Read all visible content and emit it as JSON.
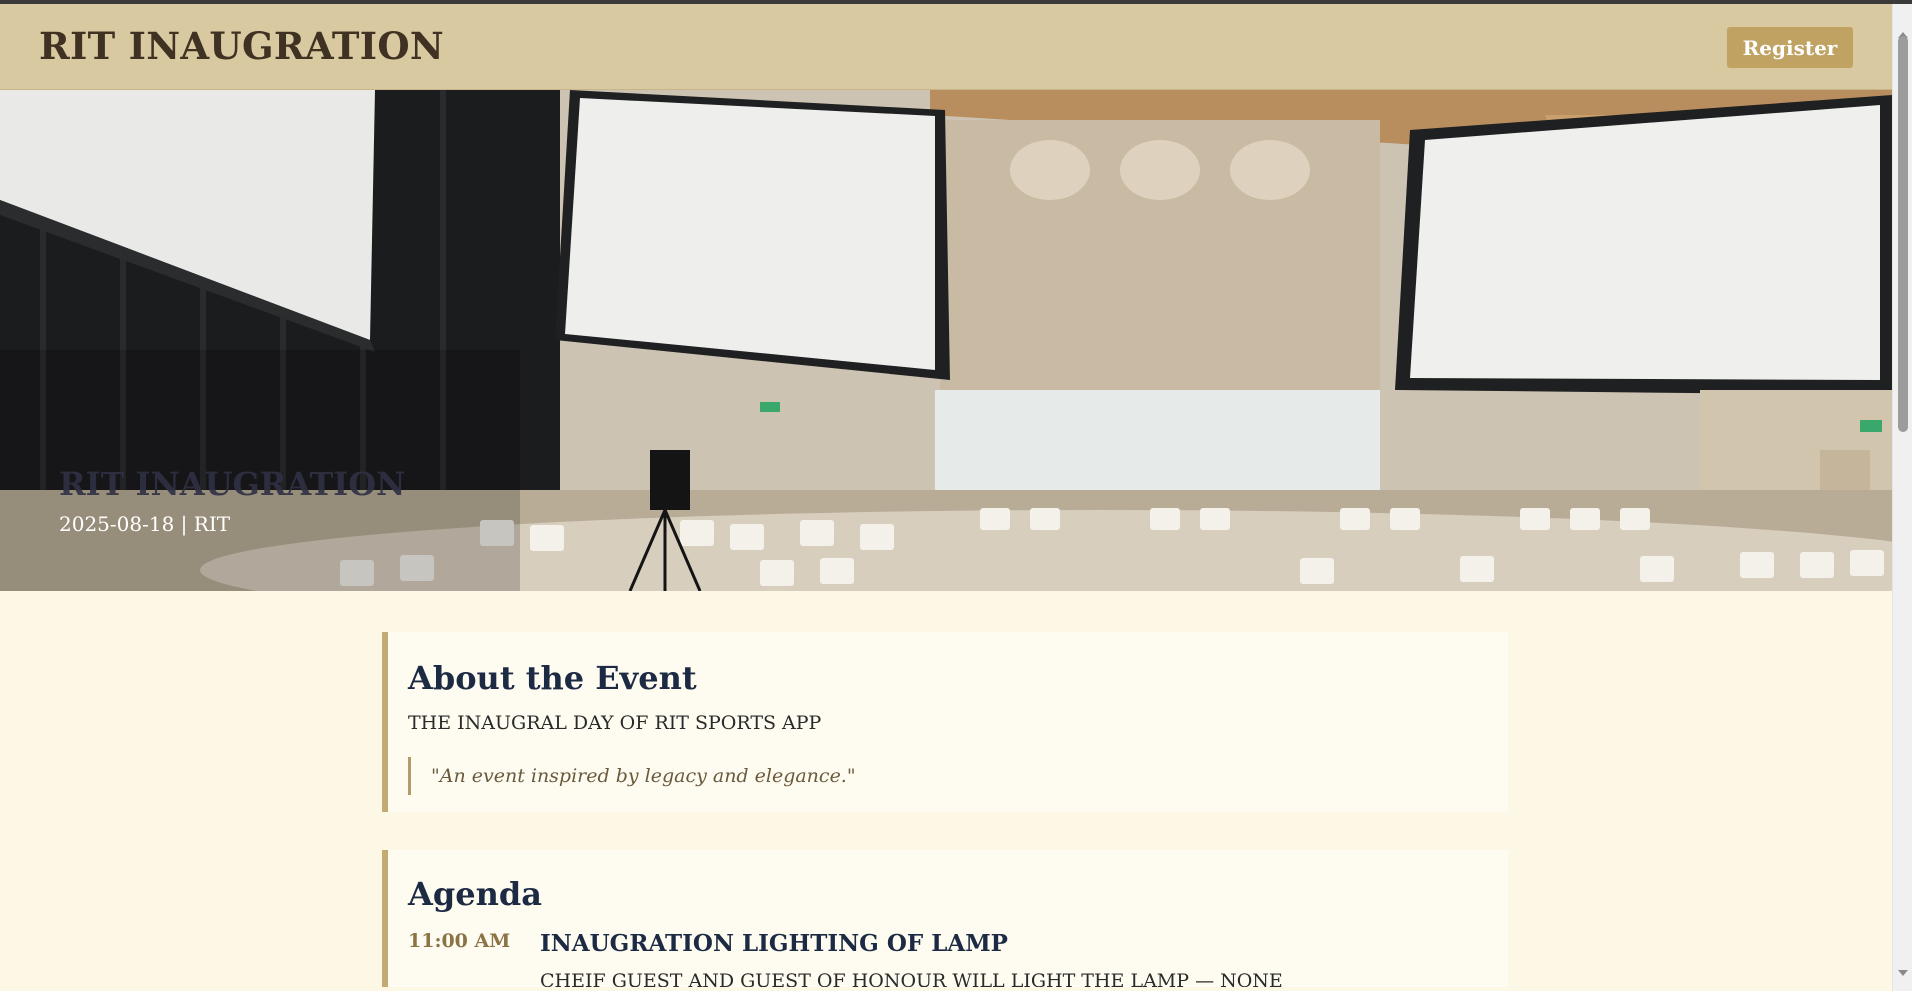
{
  "header": {
    "title": "RIT INAUGRATION",
    "register_label": "Register"
  },
  "hero": {
    "title": "RIT INAUGRATION",
    "meta": "2025-08-18 | RIT"
  },
  "about": {
    "heading": "About the Event",
    "description": "THE INAUGRAL DAY OF RIT SPORTS APP",
    "quote": "\"An event inspired by legacy and elegance.\""
  },
  "agenda": {
    "heading": "Agenda",
    "items": [
      {
        "time": "11:00 AM",
        "title": "INAUGRATION LIGHTING OF LAMP",
        "description": "CHEIF GUEST AND GUEST OF HONOUR WILL LIGHT THE LAMP — NONE"
      }
    ]
  },
  "colors": {
    "header_bg": "#d9c9a0",
    "accent": "#c0a263",
    "page_bg": "#fdf7e6",
    "heading": "#1c2a44"
  }
}
